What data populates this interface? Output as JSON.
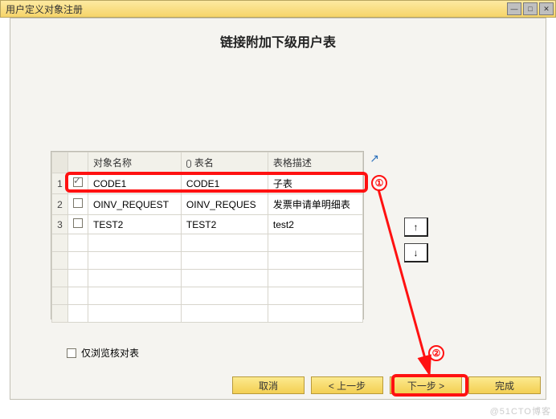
{
  "window": {
    "title": "用户定义对象注册",
    "controls": {
      "min": "—",
      "max": "□",
      "close": "✕"
    }
  },
  "panel": {
    "title": "链接附加下级用户表"
  },
  "table": {
    "headers": {
      "chk": "",
      "name": "对象名称",
      "tbl": "表名",
      "desc": "表格描述"
    },
    "rows": [
      {
        "num": "1",
        "checked": true,
        "name": "CODE1",
        "tbl": "CODE1",
        "desc": "子表"
      },
      {
        "num": "2",
        "checked": false,
        "name": "OINV_REQUEST",
        "tbl": "OINV_REQUES",
        "desc": "发票申请单明细表"
      },
      {
        "num": "3",
        "checked": false,
        "name": "TEST2",
        "tbl": "TEST2",
        "desc": "test2"
      }
    ],
    "blank_rows": 5
  },
  "browse_only": {
    "label": "仅浏览核对表",
    "checked": false
  },
  "move": {
    "up": "↑",
    "down": "↓"
  },
  "buttons": {
    "cancel": "取消",
    "prev": "< 上一步",
    "next": "下一步 >",
    "finish": "完成"
  },
  "annotations": {
    "badge1": "①",
    "badge2": "②"
  },
  "expand_glyph": "↗",
  "watermark": "@51CTO博客"
}
